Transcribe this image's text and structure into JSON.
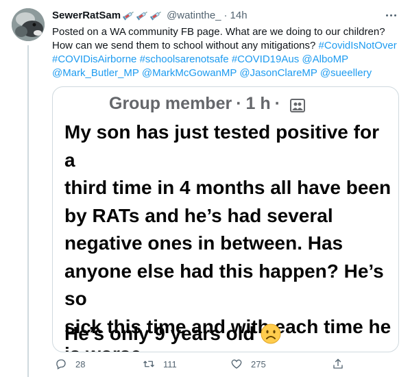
{
  "tweet": {
    "author_name": "SewerRatSam",
    "author_handle": "@watinthe_",
    "separator": "·",
    "timestamp": "14h",
    "text_plain": "Posted on a WA community FB page. What are we doing to our children? How can we send them to school without any mitigations? ",
    "hashtags_and_mentions": [
      "#CovidIsNotOver",
      "#COVIDisAirborne",
      "#schoolsarenotsafe",
      "#COVID19Aus",
      "@AlboMP",
      "@Mark_Butler_MP",
      "@MarkMcGowanMP",
      "@JasonClareMP",
      "@sueellery"
    ]
  },
  "embedded_post": {
    "author": "Group member",
    "separator": "·",
    "age": "1 h",
    "separator2": "·",
    "body_lines": [
      "My son has just tested positive for a",
      "third time in 4 months all have been",
      "by RATs and he’s had several",
      "negative ones in between. Has",
      "anyone else had this happen? He’s so",
      "sick this time and with each time he",
      "is worse."
    ],
    "last_line": "He’s only 9 years old"
  },
  "actions": {
    "reply_count": "28",
    "retweet_count": "111",
    "like_count": "275"
  },
  "colors": {
    "link": "#1d9bf0",
    "secondary_text": "#536471",
    "border": "#cfd9de",
    "fb_gray": "#65676b"
  },
  "icons": [
    "syringe-emoji",
    "more-icon",
    "group-icon",
    "frowning-face-emoji",
    "reply-icon",
    "retweet-icon",
    "like-icon",
    "share-icon"
  ]
}
